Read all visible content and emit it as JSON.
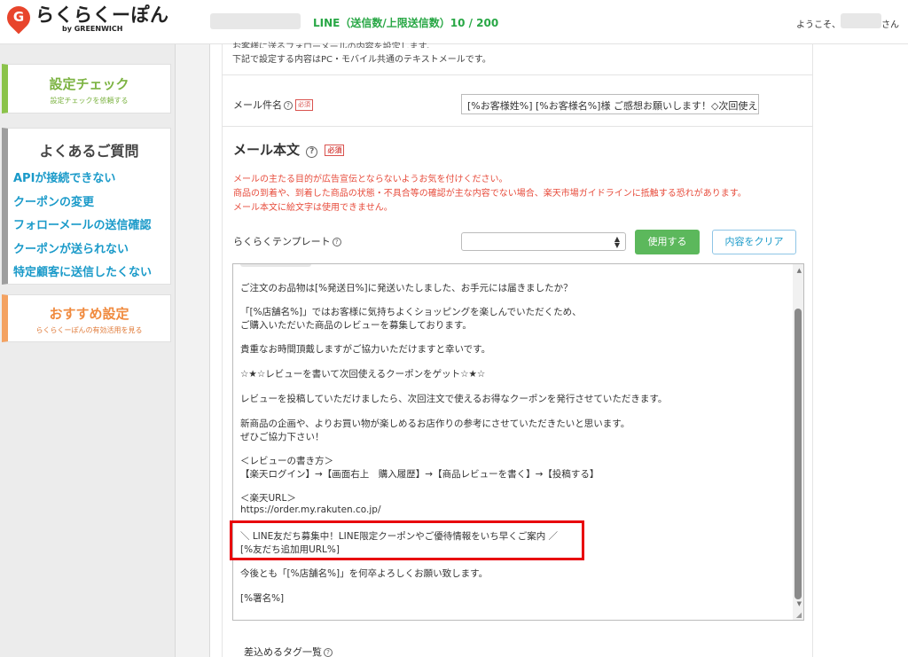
{
  "header": {
    "logo_main": "らくらくーぽん",
    "logo_sub": "by GREENWICH",
    "logo_glyph": "G",
    "line_count": "LINE（送信数/上限送信数）10 / 200",
    "welcome": "ようこそ、",
    "san": "さん"
  },
  "sidebar": {
    "check": {
      "title": "設定チェック",
      "sub": "設定チェックを依頼する"
    },
    "faq": {
      "title": "よくあるご質問",
      "items": [
        "APIが接続できない",
        "クーポンの変更",
        "フォローメールの送信確認",
        "クーポンが送られない",
        "特定顧客に送信したくない"
      ]
    },
    "recommend": {
      "title": "おすすめ設定",
      "sub": "らくらくーぽんの有効活用を見る"
    }
  },
  "main": {
    "intro_line1": "お客様に送るフォローメールの内容を設定します。",
    "intro_line2": "下記で設定する内容はPC・モバイル共通のテキストメールです。",
    "subject_label": "メール件名",
    "required": "必須",
    "subject_value": "[%お客様姓%] [%お客様名%]様 ご感想お願いします！◇次回使え",
    "body_title": "メール本文",
    "warnings": [
      "メールの主たる目的が広告宣伝とならないようお気を付けください。",
      "商品の到着や、到着した商品の状態・不具合等の確認が主な内容でない場合、楽天市場ガイドラインに抵触する恐れがあります。",
      "メール本文に絵文字は使用できません。"
    ],
    "template_label": "らくらくテンプレート",
    "template_value": "",
    "use_button": "使用する",
    "clear_button": "内容をクリア",
    "body_lines": [
      "ご注文のお品物は[%発送日%]に発送いたしました、お手元には届きましたか？",
      "「[%店舗名%]」ではお客様に気持ちよくショッピングを楽しんでいただくため、",
      "ご購入いただいた商品のレビューを募集しております。",
      "貴重なお時間頂戴しますがご協力いただけますと幸いです。",
      "☆★☆レビューを書いて次回使えるクーポンをゲット☆★☆",
      "レビューを投稿していただけましたら、次回注文で使えるお得なクーポンを発行させていただきます。",
      "新商品の企画や、よりお買い物が楽しめるお店作りの参考にさせていただきたいと思います。",
      "ぜひご協力下さい！",
      "＜レビューの書き方＞",
      "【楽天ログイン】→【画面右上　購入履歴】→【商品レビューを書く】→【投稿する】",
      "＜楽天URL＞",
      "https://order.my.rakuten.co.jp/",
      "＼ LINE友だち募集中！LINE限定クーポンやご優待情報をいち早くご案内 ／",
      "[%友だち追加用URL%]",
      "今後とも「[%店舗名%]」を何卒よろしくお願い致します。",
      "[%署名%]"
    ],
    "tags_label": "差込めるタグ一覧"
  },
  "icons": {
    "help": "?",
    "select_arrows": "▲▼",
    "scroll_up": "▲",
    "scroll_down": "▼",
    "resize": "◢"
  },
  "colors": {
    "accent_green": "#5cb85c",
    "link_blue": "#1a9ac9",
    "warning_red": "#e74c3c",
    "highlight_red": "#e8000b"
  }
}
